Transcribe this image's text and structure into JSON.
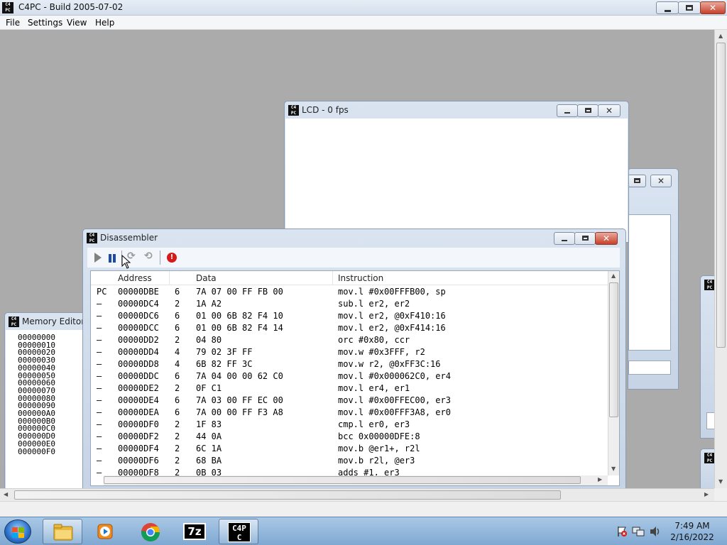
{
  "app": {
    "title": "C4PC - Build 2005-07-02",
    "icon_text": "C4PC",
    "menu": [
      "File",
      "Settings",
      "View",
      "Help"
    ]
  },
  "lcd": {
    "title": "LCD - 0 fps"
  },
  "memory_editor": {
    "title": "Memory Editor",
    "addresses": [
      "00000000",
      "00000010",
      "00000020",
      "00000030",
      "00000040",
      "00000050",
      "00000060",
      "00000070",
      "00000080",
      "00000090",
      "000000A0",
      "000000B0",
      "000000C0",
      "000000D0",
      "000000E0",
      "000000F0"
    ]
  },
  "disassembler": {
    "title": "Disassembler",
    "columns": [
      "Address",
      "Data",
      "Instruction"
    ],
    "rows": [
      {
        "marker": "PC",
        "address": "00000DBE",
        "size": "6",
        "data": "7A 07 00 FF FB 00",
        "instr": "mov.l #0x00FFFB00, sp"
      },
      {
        "marker": "–",
        "address": "00000DC4",
        "size": "2",
        "data": "1A A2",
        "instr": "sub.l er2, er2"
      },
      {
        "marker": "–",
        "address": "00000DC6",
        "size": "6",
        "data": "01 00 6B 82 F4 10",
        "instr": "mov.l er2, @0xF410:16"
      },
      {
        "marker": "–",
        "address": "00000DCC",
        "size": "6",
        "data": "01 00 6B 82 F4 14",
        "instr": "mov.l er2, @0xF414:16"
      },
      {
        "marker": "–",
        "address": "00000DD2",
        "size": "2",
        "data": "04 80",
        "instr": "orc #0x80, ccr"
      },
      {
        "marker": "–",
        "address": "00000DD4",
        "size": "4",
        "data": "79 02 3F FF",
        "instr": "mov.w #0x3FFF, r2"
      },
      {
        "marker": "–",
        "address": "00000DD8",
        "size": "4",
        "data": "6B 82 FF 3C",
        "instr": "mov.w r2, @0xFF3C:16"
      },
      {
        "marker": "–",
        "address": "00000DDC",
        "size": "6",
        "data": "7A 04 00 00 62 C0",
        "instr": "mov.l #0x000062C0, er4"
      },
      {
        "marker": "–",
        "address": "00000DE2",
        "size": "2",
        "data": "0F C1",
        "instr": "mov.l er4, er1"
      },
      {
        "marker": "–",
        "address": "00000DE4",
        "size": "6",
        "data": "7A 03 00 FF EC 00",
        "instr": "mov.l #0x00FFEC00, er3"
      },
      {
        "marker": "–",
        "address": "00000DEA",
        "size": "6",
        "data": "7A 00 00 FF F3 A8",
        "instr": "mov.l #0x00FFF3A8, er0"
      },
      {
        "marker": "–",
        "address": "00000DF0",
        "size": "2",
        "data": "1F 83",
        "instr": "cmp.l er0, er3"
      },
      {
        "marker": "–",
        "address": "00000DF2",
        "size": "2",
        "data": "44 0A",
        "instr": "bcc 0x00000DFE:8"
      },
      {
        "marker": "–",
        "address": "00000DF4",
        "size": "2",
        "data": "6C 1A",
        "instr": "mov.b @er1+, r2l"
      },
      {
        "marker": "–",
        "address": "00000DF6",
        "size": "2",
        "data": "68 BA",
        "instr": "mov.b r2l, @er3"
      },
      {
        "marker": "–",
        "address": "00000DF8",
        "size": "2",
        "data": "0B 03",
        "instr": "adds #1, er3"
      }
    ]
  },
  "taskbar": {
    "apps": [
      "explorer-icon",
      "media-player-icon",
      "chrome-icon",
      "7zip-icon",
      "c4pc-icon"
    ],
    "sevenzip_label": "7z",
    "c4pc_label": "C4PC",
    "clock_time": "7:49 AM",
    "clock_date": "2/16/2022"
  },
  "colors": {
    "mdi_background": "#ababab",
    "accent": "#1c4aa6",
    "close_red": "#c7402b"
  }
}
